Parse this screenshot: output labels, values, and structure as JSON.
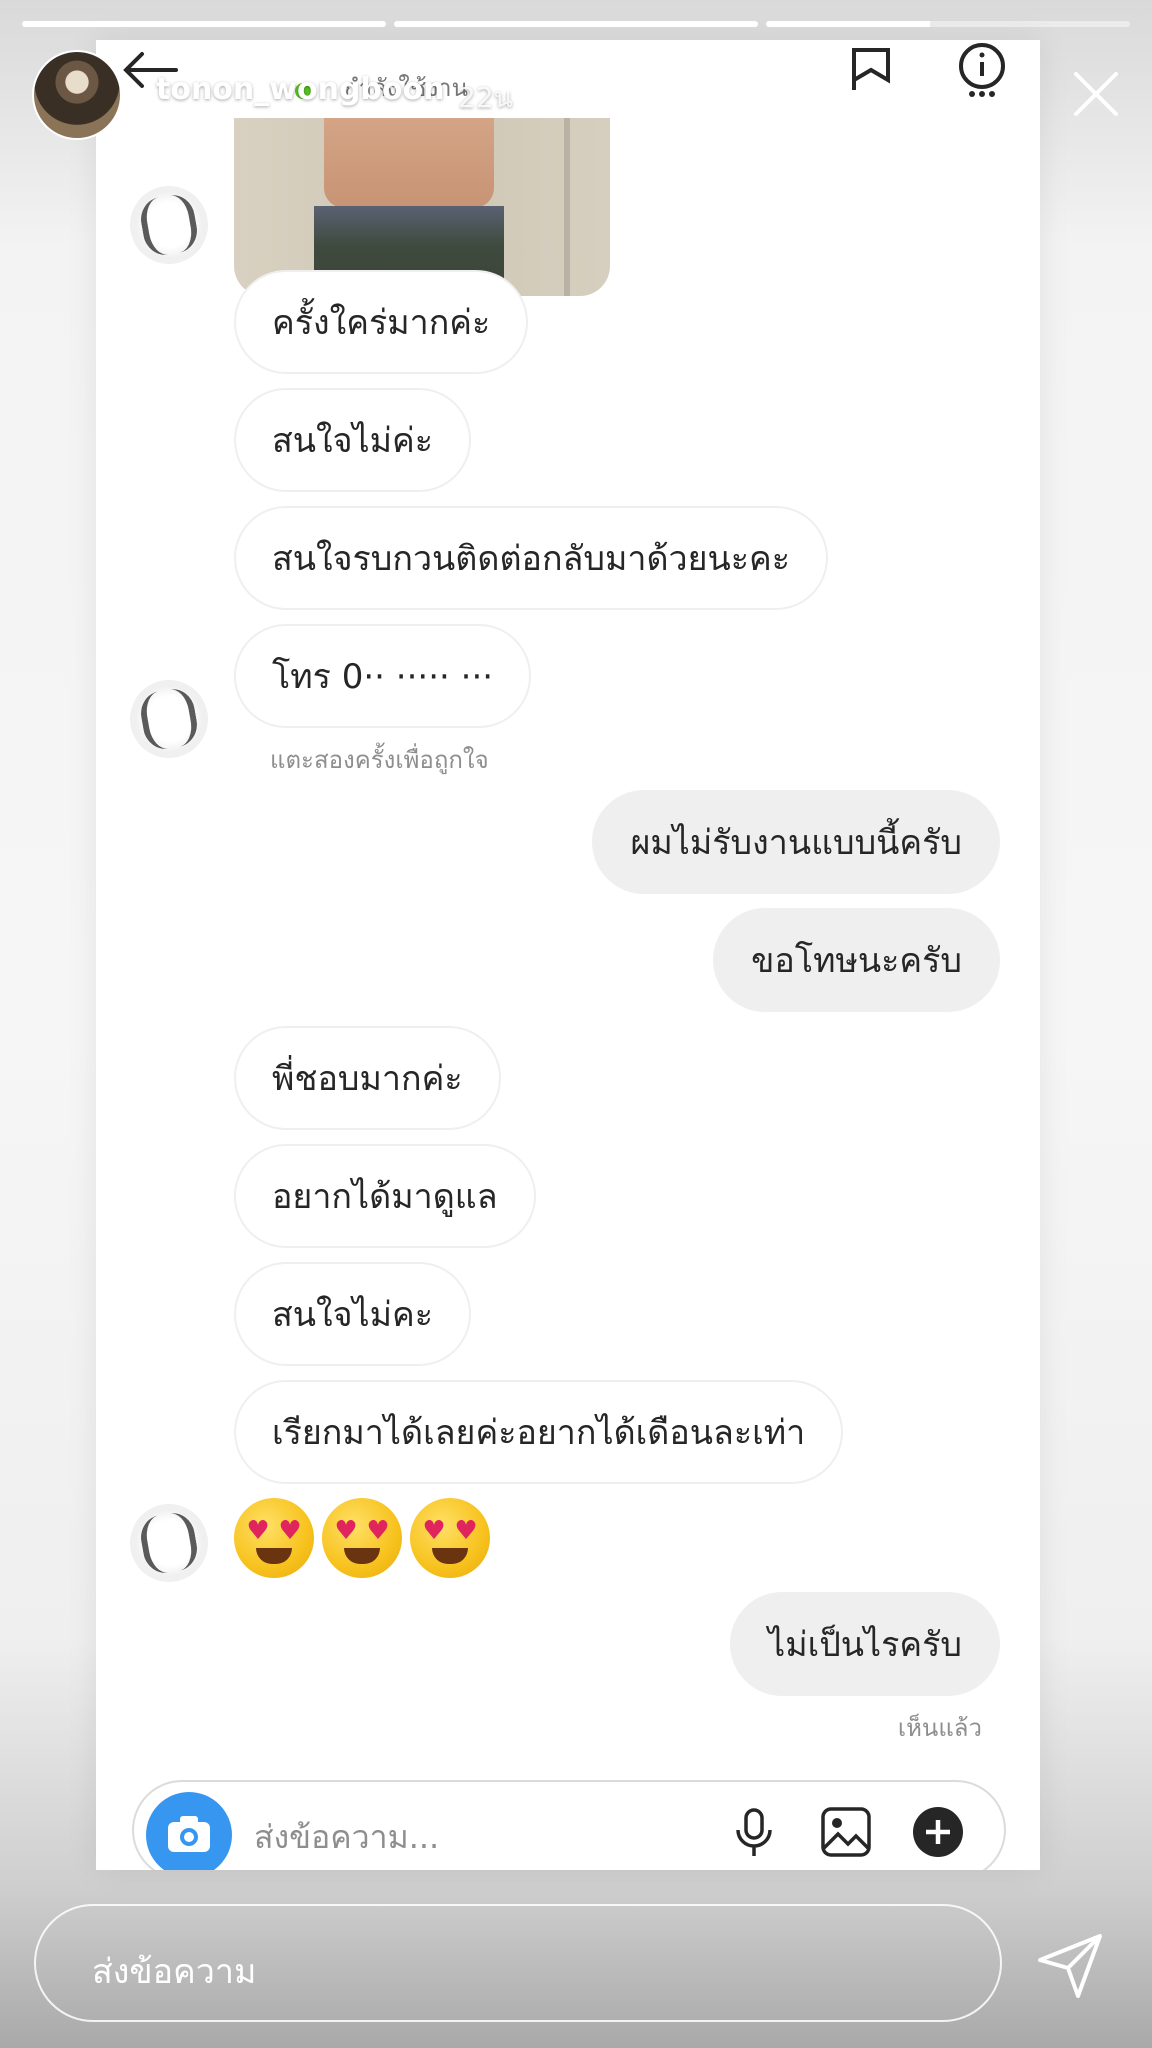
{
  "story": {
    "username": "tonon_wongboon",
    "age": "22น",
    "progress": [
      1.0,
      1.0,
      0.45
    ],
    "reply_placeholder": "ส่งข้อความ"
  },
  "dm": {
    "status": "กำลังใช้งาน",
    "messages": [
      {
        "side": "in",
        "text": "ครั้งใคร่มากค่ะ"
      },
      {
        "side": "in",
        "text": "สนใจไม่ค่ะ"
      },
      {
        "side": "in",
        "text": "สนใจรบกวนติดต่อกลับมาด้วยนะคะ"
      },
      {
        "side": "in",
        "text": "โทร 0·· ····· ···"
      },
      {
        "side": "out",
        "text": "ผมไม่รับงานแบบนี้ครับ"
      },
      {
        "side": "out",
        "text": "ขอโทษนะครับ"
      },
      {
        "side": "in",
        "text": "พี่ชอบมากค่ะ"
      },
      {
        "side": "in",
        "text": "อยากได้มาดูแล"
      },
      {
        "side": "in",
        "text": "สนใจไม่คะ"
      },
      {
        "side": "in",
        "text": "เรียกมาได้เลยค่ะอยากได้เดือนละเท่า"
      },
      {
        "side": "out",
        "text": "ไม่เป็นไรครับ"
      }
    ],
    "double_tap_hint": "แตะสองครั้งเพื่อถูกใจ",
    "seen_label": "เห็นแล้ว",
    "composer_placeholder": "ส่งข้อความ...",
    "emoji_count": 3
  },
  "colors": {
    "accent": "#3797f0",
    "online": "#58c322",
    "bubble_out": "#efefef"
  },
  "icons": [
    "back-arrow-icon",
    "flag-icon",
    "info-icon",
    "close-icon",
    "camera-icon",
    "microphone-icon",
    "image-icon",
    "plus-icon",
    "send-icon"
  ]
}
